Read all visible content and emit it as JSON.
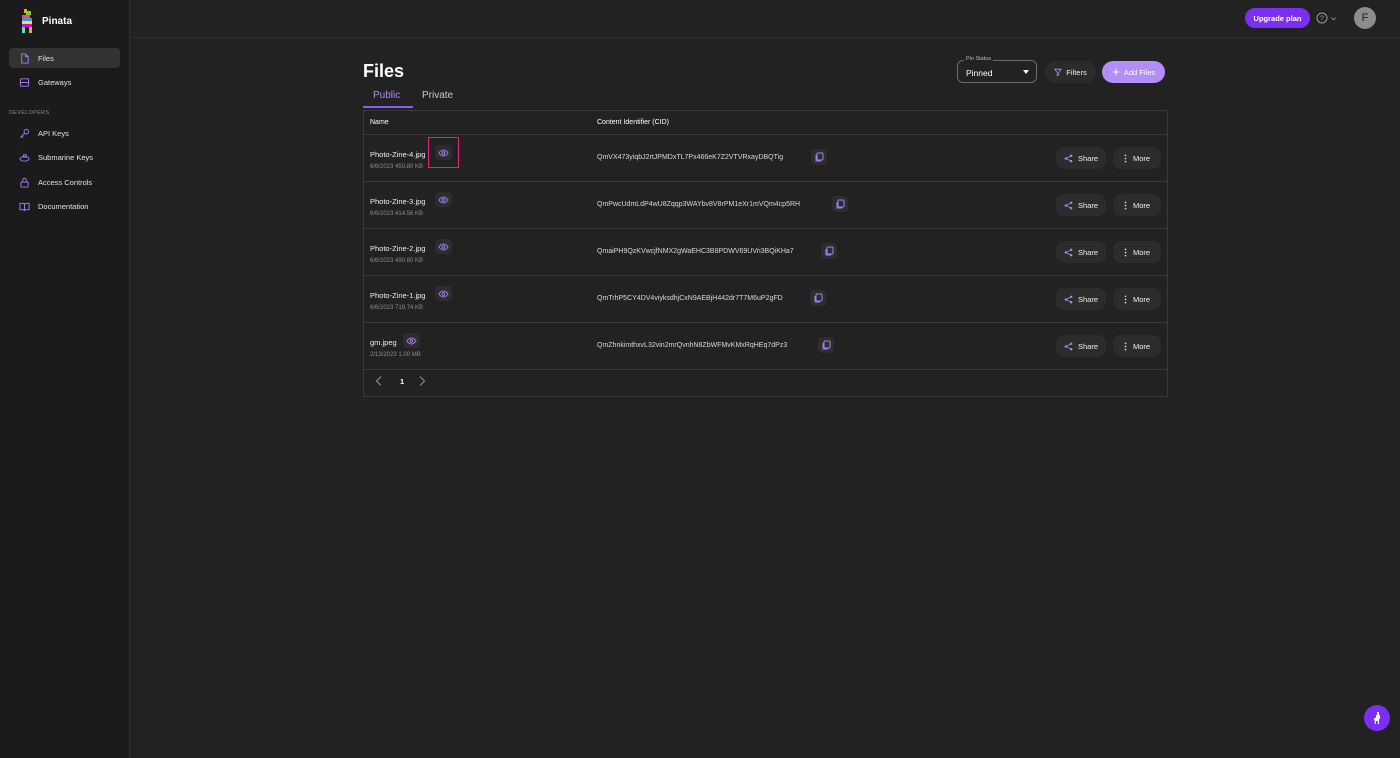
{
  "brand": {
    "name": "Pinata"
  },
  "sidebar": {
    "items": [
      {
        "label": "Files",
        "icon": "file-icon",
        "active": true
      },
      {
        "label": "Gateways",
        "icon": "gateway-icon",
        "active": false
      }
    ],
    "section_label": "DEVELOPERS",
    "dev_items": [
      {
        "label": "API Keys",
        "icon": "key-icon"
      },
      {
        "label": "Submarine Keys",
        "icon": "submarine-icon"
      },
      {
        "label": "Access Controls",
        "icon": "lock-icon"
      },
      {
        "label": "Documentation",
        "icon": "book-icon"
      }
    ]
  },
  "topbar": {
    "upgrade_label": "Upgrade plan",
    "avatar_initial": "F"
  },
  "page": {
    "title": "Files",
    "tabs": [
      "Public",
      "Private"
    ],
    "active_tab": "Public"
  },
  "pin_status": {
    "label": "Pin Status",
    "value": "Pinned"
  },
  "toolbar": {
    "filters_label": "Filters",
    "add_files_label": "Add Files"
  },
  "table": {
    "columns": [
      "Name",
      "Content Identifier (CID)"
    ],
    "rows": [
      {
        "name": "Photo-Zine-4.jpg",
        "meta": "6/6/2023 450.80 KB",
        "cid": "QmVX473yiqbJ2rtJPMDxTL7Px466eK7Z2VTVRxayDBQTig",
        "share": "Share",
        "more": "More"
      },
      {
        "name": "Photo-Zine-3.jpg",
        "meta": "6/6/2023 414.56 KB",
        "cid": "QmPwcUdmLdP4wU8Zqqp3WAYbv8V8rPM1eXr1mVQm4cp5RH",
        "share": "Share",
        "more": "More"
      },
      {
        "name": "Photo-Zine-2.jpg",
        "meta": "6/6/2023 490.60 KB",
        "cid": "QmaiPH9QzKVwcjfNMX2gWaEHC3B8PDWV69UVri3BQiKHa7",
        "share": "Share",
        "more": "More"
      },
      {
        "name": "Photo-Zine-1.jpg",
        "meta": "6/6/2023 719.74 KB",
        "cid": "QmTrhP5CY4DV4viyksdhjCxN9AEBjH442dr7T7M6uP2gFD",
        "share": "Share",
        "more": "More"
      },
      {
        "name": "gm.jpeg",
        "meta": "2/13/2023 1.00 MB",
        "cid": "QmZhnkimthxvL32vin2mrQvnhN8ZbWFMvKMxRqHEq7dPz3",
        "share": "Share",
        "more": "More"
      }
    ]
  },
  "pagination": {
    "current_page": "1"
  },
  "colors": {
    "accent": "#7b2ff2",
    "accent_light": "#b28ef7",
    "highlight": "#e0247a",
    "background": "#222222",
    "sidebar_bg": "#1b1b1b"
  }
}
